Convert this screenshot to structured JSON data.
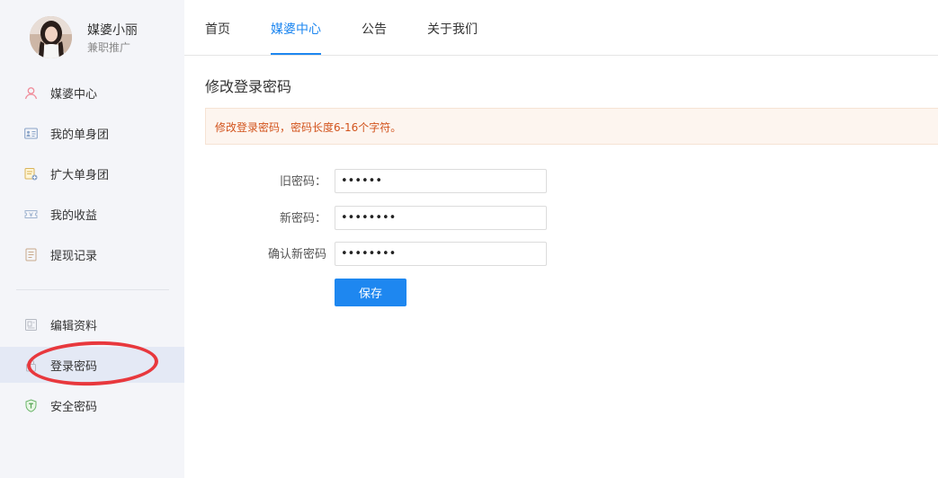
{
  "profile": {
    "name": "媒婆小丽",
    "role": "兼职推广"
  },
  "sidebar": {
    "items": [
      {
        "label": "媒婆中心",
        "icon": "user-icon"
      },
      {
        "label": "我的单身团",
        "icon": "id-card-icon"
      },
      {
        "label": "扩大单身团",
        "icon": "add-group-icon"
      },
      {
        "label": "我的收益",
        "icon": "ticket-icon"
      },
      {
        "label": "提现记录",
        "icon": "list-icon"
      }
    ],
    "settings": [
      {
        "label": "编辑资料",
        "icon": "edit-profile-icon"
      },
      {
        "label": "登录密码",
        "icon": "lock-icon",
        "active": true
      },
      {
        "label": "安全密码",
        "icon": "shield-icon"
      }
    ]
  },
  "topnav": {
    "tabs": [
      {
        "label": "首页"
      },
      {
        "label": "媒婆中心",
        "active": true
      },
      {
        "label": "公告"
      },
      {
        "label": "关于我们"
      }
    ]
  },
  "main": {
    "title": "修改登录密码",
    "notice": "修改登录密码，密码长度6-16个字符。",
    "fields": [
      {
        "label": "旧密码：",
        "value": "••••••"
      },
      {
        "label": "新密码：",
        "value": "••••••••"
      },
      {
        "label": "确认新密码",
        "value": "••••••••"
      }
    ],
    "save_label": "保存"
  },
  "colors": {
    "accent": "#1e87f0",
    "sidebar_bg": "#f4f5f9",
    "active_item_bg": "#e4e9f5",
    "notice_bg": "#fdf5ef",
    "notice_text": "#d2531c",
    "annotation": "#e8383d"
  }
}
